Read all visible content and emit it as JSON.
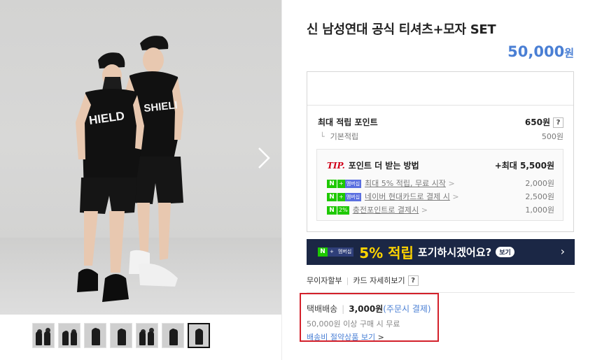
{
  "product": {
    "title": "신 남성연대 공식 티셔츠+모자 SET",
    "price": "50,000",
    "currency": "원"
  },
  "gallery": {
    "shirt_text_left": "HIELD",
    "shirt_text_right": "SHIELI",
    "thumbnail_count": 7,
    "active_thumbnail": 7
  },
  "points": {
    "max_label": "최대 적립 포인트",
    "max_value": "650원",
    "help_mark": "?",
    "basic_label": "기본적립",
    "basic_value": "500원"
  },
  "tip": {
    "badge": "TIP.",
    "title": "포인트 더 받는 방법",
    "max": "+최대 5,500원",
    "rows": [
      {
        "badge_n": "N",
        "badge_plus": "+",
        "badge_tag": "멤버십",
        "text": "최대 5% 적립, 무료 시작",
        "chevron": ">",
        "amount": "2,000원"
      },
      {
        "badge_n": "N",
        "badge_plus": "+",
        "badge_tag": "멤버십",
        "text": "네이버 현대카드로 결제 시",
        "chevron": ">",
        "amount": "2,500원"
      },
      {
        "badge_n": "N",
        "badge_plus": "2%",
        "badge_tag": "",
        "text": "충전포인트로 결제시",
        "chevron": ">",
        "amount": "1,000원"
      }
    ]
  },
  "banner": {
    "badge_n": "N",
    "badge_plus": "+",
    "badge_tag": "멤버십",
    "percent": "5% 적립",
    "message": "포기하시겠어요?",
    "see": "보기",
    "chevron": "›"
  },
  "payment": {
    "installment": "무이자할부",
    "card_detail": "카드 자세히보기",
    "help_mark": "?"
  },
  "shipping": {
    "label": "택배배송",
    "fee": "3,000원",
    "condition": "(주문시 결제)",
    "free_text": "50,000원 이상 구매 시 무료",
    "link": "배송비 절약상품 보기",
    "link_chevron": ">"
  },
  "colors": {
    "price": "#4a7fd4",
    "banner_bg": "#1b2745",
    "banner_accent": "#ffd400",
    "naver_green": "#1ec800",
    "highlight_red": "#d3202a"
  }
}
